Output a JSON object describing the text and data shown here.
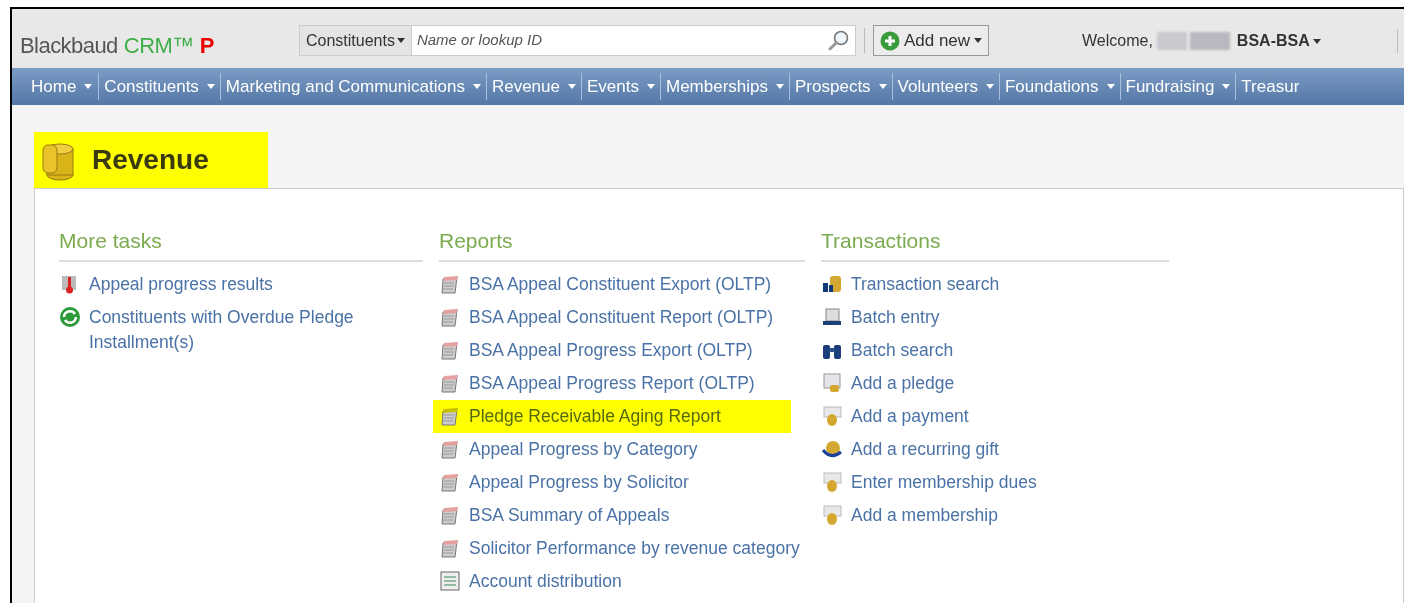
{
  "header": {
    "logo": {
      "brand": "Blackbaud",
      "product": "CRM™",
      "edition": "P"
    },
    "search": {
      "category": "Constituents",
      "placeholder": "Name or lookup ID"
    },
    "add_button": "Add new",
    "welcome": {
      "greeting": "Welcome,",
      "user": "BSA-BSA"
    }
  },
  "nav": [
    {
      "label": "Home"
    },
    {
      "label": "Constituents"
    },
    {
      "label": "Marketing and Communications"
    },
    {
      "label": "Revenue"
    },
    {
      "label": "Events"
    },
    {
      "label": "Memberships"
    },
    {
      "label": "Prospects"
    },
    {
      "label": "Volunteers"
    },
    {
      "label": "Foundations"
    },
    {
      "label": "Fundraising"
    },
    {
      "label": "Treasur"
    }
  ],
  "page": {
    "title": "Revenue",
    "highlighted": true
  },
  "sections": [
    {
      "heading": "More tasks",
      "items": [
        {
          "label": "Appeal progress results",
          "highlighted": false
        },
        {
          "label": "Constituents with Overdue Pledge Installment(s)",
          "highlighted": false
        }
      ]
    },
    {
      "heading": "Reports",
      "items": [
        {
          "label": "BSA Appeal Constituent Export (OLTP)",
          "highlighted": false
        },
        {
          "label": "BSA Appeal Constituent Report (OLTP)",
          "highlighted": false
        },
        {
          "label": "BSA Appeal Progress Export (OLTP)",
          "highlighted": false
        },
        {
          "label": "BSA Appeal Progress Report (OLTP)",
          "highlighted": false
        },
        {
          "label": "Pledge Receivable Aging Report",
          "highlighted": true
        },
        {
          "label": "Appeal Progress by Category",
          "highlighted": false
        },
        {
          "label": "Appeal Progress by Solicitor",
          "highlighted": false
        },
        {
          "label": "BSA Summary of Appeals",
          "highlighted": false
        },
        {
          "label": "Solicitor Performance by revenue category",
          "highlighted": false
        },
        {
          "label": "Account distribution",
          "highlighted": false
        }
      ]
    },
    {
      "heading": "Transactions",
      "items": [
        {
          "label": "Transaction search",
          "highlighted": false
        },
        {
          "label": "Batch entry",
          "highlighted": false
        },
        {
          "label": "Batch search",
          "highlighted": false
        },
        {
          "label": "Add a pledge",
          "highlighted": false
        },
        {
          "label": "Add a payment",
          "highlighted": false
        },
        {
          "label": "Add a recurring gift",
          "highlighted": false
        },
        {
          "label": "Enter membership dues",
          "highlighted": false
        },
        {
          "label": "Add a membership",
          "highlighted": false
        }
      ]
    }
  ]
}
